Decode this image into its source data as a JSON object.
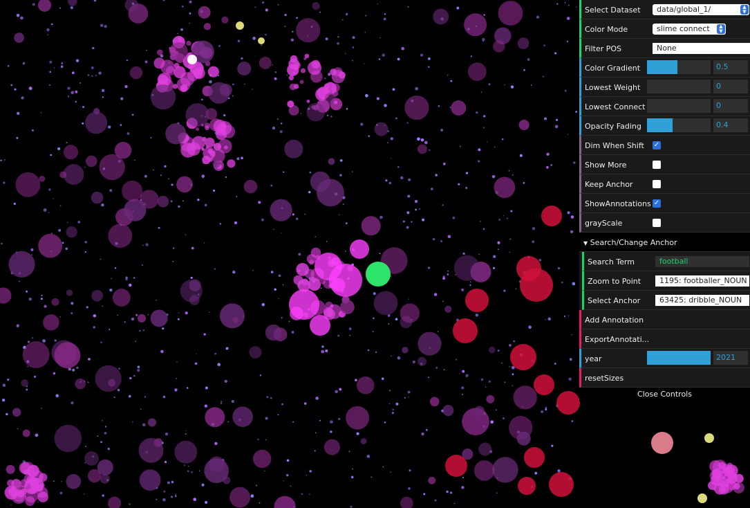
{
  "controls": {
    "select_dataset": {
      "label": "Select Dataset",
      "value": "data/global_1/"
    },
    "color_mode": {
      "label": "Color Mode",
      "value": "slime connect"
    },
    "filter_pos": {
      "label": "Filter POS",
      "value": "None"
    },
    "color_gradient": {
      "label": "Color Gradient",
      "value": "0.5",
      "fill": 0.48
    },
    "lowest_weight": {
      "label": "Lowest Weight",
      "value": "0",
      "fill": 0
    },
    "lowest_connect": {
      "label": "Lowest Connect",
      "value": "0",
      "fill": 0
    },
    "opacity_fading": {
      "label": "Opacity Fading",
      "value": "0.4",
      "fill": 0.4
    },
    "dim_when_shift": {
      "label": "Dim When Shift",
      "checked": true
    },
    "show_more": {
      "label": "Show More",
      "checked": false
    },
    "keep_anchor": {
      "label": "Keep Anchor",
      "checked": false
    },
    "show_annotations": {
      "label": "ShowAnnotations",
      "checked": true
    },
    "grayscale": {
      "label": "grayScale",
      "checked": false
    }
  },
  "anchor_folder": {
    "title": "Search/Change Anchor",
    "search_term": {
      "label": "Search Term",
      "value": "football"
    },
    "zoom_to_point": {
      "label": "Zoom to Point",
      "value": "1195: footballer_NOUN"
    },
    "select_anchor": {
      "label": "Select Anchor",
      "value": "63425: dribble_NOUN"
    }
  },
  "actions": {
    "add_annotation": "Add Annotation",
    "export_annotations": "ExportAnnotati...",
    "reset_sizes": "resetSizes"
  },
  "year": {
    "label": "year",
    "value": "2021",
    "fill": 1.0
  },
  "close_controls": "Close Controls",
  "colors": {
    "magenta": "#e040e0",
    "purple": "#8a2a8a",
    "crimson": "#d0103a",
    "green": "#2de36a",
    "yellow": "#f4f08a",
    "blue_dots": "#8a8aff"
  }
}
